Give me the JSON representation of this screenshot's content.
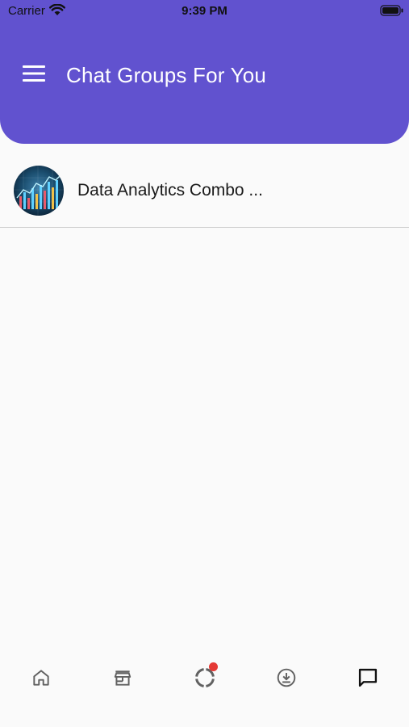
{
  "status_bar": {
    "carrier": "Carrier",
    "time": "9:39 PM"
  },
  "header": {
    "title": "Chat Groups For You",
    "background_color": "#6152cf"
  },
  "groups": [
    {
      "name": "Data Analytics Combo ...",
      "avatar": "data-analytics-chart-image"
    }
  ],
  "bottom_nav": {
    "items": [
      {
        "icon": "home-icon",
        "active": false
      },
      {
        "icon": "store-icon",
        "active": false
      },
      {
        "icon": "progress-icon",
        "active": false,
        "badge": "notification-dot"
      },
      {
        "icon": "download-icon",
        "active": false
      },
      {
        "icon": "chat-icon",
        "active": true
      }
    ],
    "badge_color": "#e53935"
  }
}
